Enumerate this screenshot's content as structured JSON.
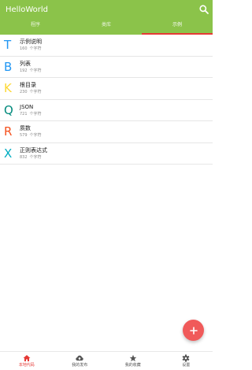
{
  "app": {
    "title": "HelloWorld"
  },
  "tabs": [
    {
      "label": "程序",
      "active": false
    },
    {
      "label": "类库",
      "active": false
    },
    {
      "label": "示例",
      "active": true
    }
  ],
  "items": [
    {
      "letter": "T",
      "color": "#2196f3",
      "title": "示例说明",
      "count": "160",
      "unit": "个字符"
    },
    {
      "letter": "B",
      "color": "#2196f3",
      "title": "列表",
      "count": "192",
      "unit": "个字符"
    },
    {
      "letter": "K",
      "color": "#fdd835",
      "title": "根目录",
      "count": "230",
      "unit": "个字符"
    },
    {
      "letter": "Q",
      "color": "#00897b",
      "title": "JSON",
      "count": "721",
      "unit": "个字符"
    },
    {
      "letter": "R",
      "color": "#f4511e",
      "title": "质数",
      "count": "579",
      "unit": "个字符"
    },
    {
      "letter": "X",
      "color": "#00acc1",
      "title": "正则表达式",
      "count": "832",
      "unit": "个字符"
    }
  ],
  "bottom_nav": [
    {
      "label": "本地代码",
      "icon": "home-icon",
      "active": true
    },
    {
      "label": "我的发布",
      "icon": "cloud-upload-icon",
      "active": false
    },
    {
      "label": "我的收藏",
      "icon": "star-icon",
      "active": false
    },
    {
      "label": "设置",
      "icon": "gear-icon",
      "active": false
    }
  ],
  "colors": {
    "appbar": "#8bc34a",
    "accent": "#e53935",
    "fab": "#f05a5a"
  }
}
